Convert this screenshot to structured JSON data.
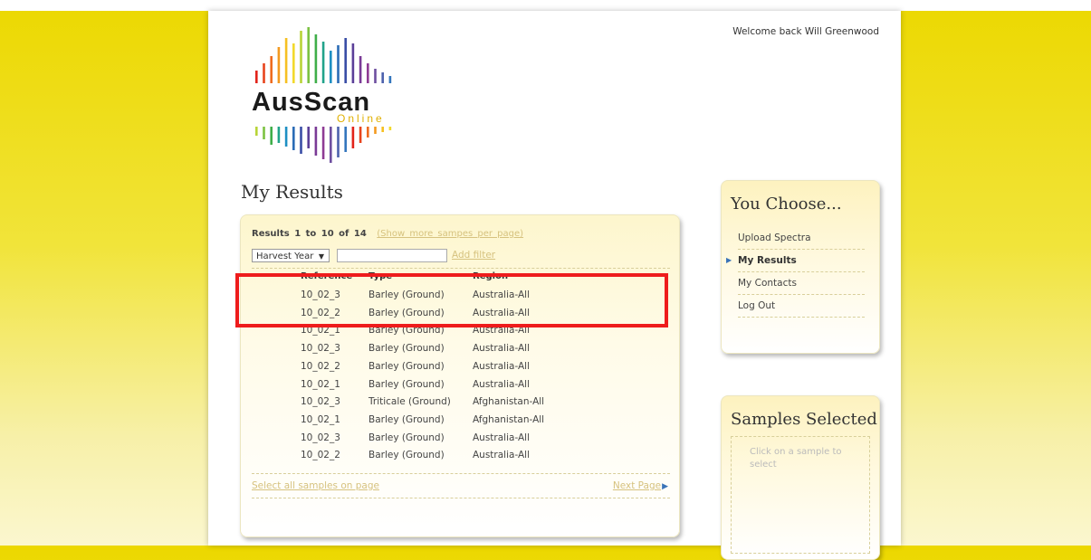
{
  "logo": {
    "name": "AusScan",
    "sub": "Online"
  },
  "header": {
    "welcome": "Welcome back Will Greenwood"
  },
  "page_title": "My Results",
  "results": {
    "summary": "Results 1 to 10 of 14",
    "show_more_link": "(Show more sampes per page)",
    "filter_select": "Harvest Year",
    "filter_input_value": "",
    "add_filter_link": "Add filter",
    "columns": [
      "Reference",
      "Type",
      "Region"
    ],
    "rows": [
      [
        "10_02_3",
        "Barley (Ground)",
        "Australia-All"
      ],
      [
        "10_02_2",
        "Barley (Ground)",
        "Australia-All"
      ],
      [
        "10_02_1",
        "Barley (Ground)",
        "Australia-All"
      ],
      [
        "10_02_3",
        "Barley (Ground)",
        "Australia-All"
      ],
      [
        "10_02_2",
        "Barley (Ground)",
        "Australia-All"
      ],
      [
        "10_02_1",
        "Barley (Ground)",
        "Australia-All"
      ],
      [
        "10_02_3",
        "Triticale (Ground)",
        "Afghanistan-All"
      ],
      [
        "10_02_1",
        "Barley (Ground)",
        "Afghanistan-All"
      ],
      [
        "10_02_3",
        "Barley (Ground)",
        "Australia-All"
      ],
      [
        "10_02_2",
        "Barley (Ground)",
        "Australia-All"
      ]
    ],
    "select_all_link": "Select all samples on page",
    "next_page_link": "Next Page"
  },
  "sidebar": {
    "choose_title": "You Choose...",
    "menu": [
      {
        "label": "Upload Spectra",
        "active": false
      },
      {
        "label": "My Results",
        "active": true
      },
      {
        "label": "My Contacts",
        "active": false
      },
      {
        "label": "Log Out",
        "active": false
      }
    ],
    "samples_title": "Samples Selected",
    "samples_hint": "Click on a sample to select"
  },
  "colors": {
    "background_yellow": "#ecd800",
    "link": "#d6c27e",
    "highlight_border": "#ee1c1c",
    "bullet": "#3a73b8"
  }
}
